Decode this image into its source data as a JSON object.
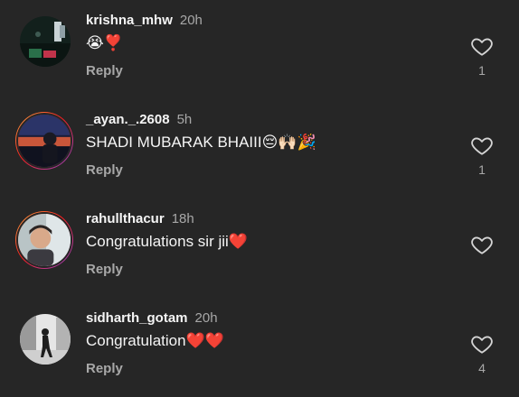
{
  "colors": {
    "background": "#262626",
    "primary_text": "#f5f5f5",
    "secondary_text": "#a8a8a8",
    "heart_red": "#ff3040",
    "story_ring": [
      "#fcb045",
      "#fd1d1d",
      "#c13584",
      "#833ab4"
    ]
  },
  "reply_label": "Reply",
  "comments": [
    {
      "username": "krishna_mhw",
      "time": "20h",
      "text": "",
      "emojis": "😭❣️",
      "likes": "1",
      "has_story_ring": false,
      "like_icon": "heart-outline-icon"
    },
    {
      "username": "_ayan._.2608",
      "time": "5h",
      "text": "SHADI MUBARAK BHAIII",
      "emojis": "😔🙌🏻🎉",
      "likes": "1",
      "has_story_ring": true,
      "like_icon": "heart-outline-icon"
    },
    {
      "username": "rahullthacur",
      "time": "18h",
      "text": "Congratulations sir jii",
      "emojis": "❤️",
      "likes": "",
      "has_story_ring": true,
      "like_icon": "heart-outline-icon"
    },
    {
      "username": "sidharth_gotam",
      "time": "20h",
      "text": "Congratulation",
      "emojis": "❤️❤️",
      "likes": "4",
      "has_story_ring": false,
      "like_icon": "heart-outline-icon"
    }
  ]
}
